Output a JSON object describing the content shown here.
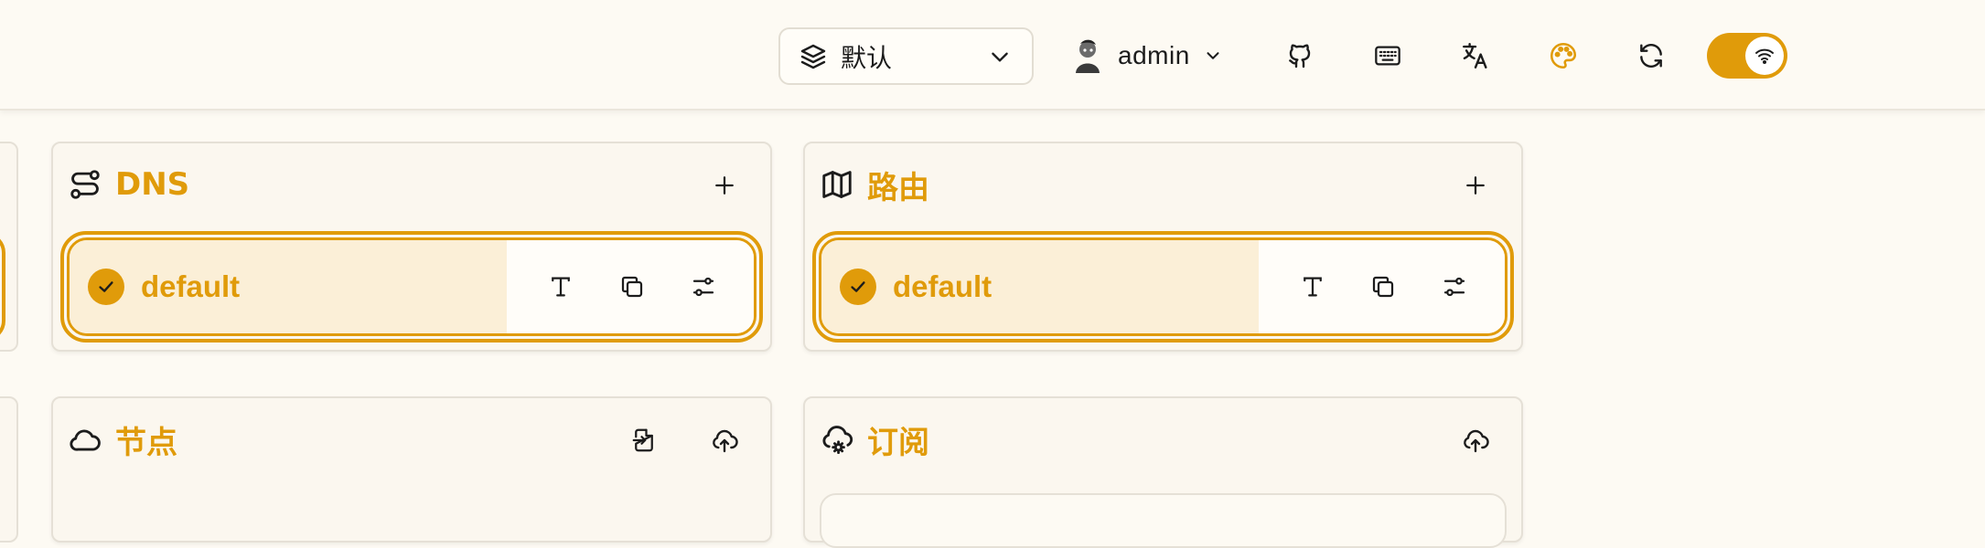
{
  "header": {
    "profile_label": "默认",
    "username": "admin"
  },
  "cards": {
    "dns": {
      "title": "DNS",
      "item_label": "default"
    },
    "route": {
      "title": "路由",
      "item_label": "default"
    },
    "nodes": {
      "title": "节点"
    },
    "subscription": {
      "title": "订阅"
    }
  },
  "colors": {
    "accent": "#e09b0a",
    "background": "#fdfaf3",
    "card": "#fbf7ef",
    "selected_item": "#fbefd7"
  },
  "icons": {
    "profile": "layers-icon",
    "github": "github-icon",
    "keyboard": "keyboard-icon",
    "language": "translate-icon",
    "theme": "palette-icon",
    "refresh": "refresh-icon",
    "toggle": "wifi-icon"
  }
}
